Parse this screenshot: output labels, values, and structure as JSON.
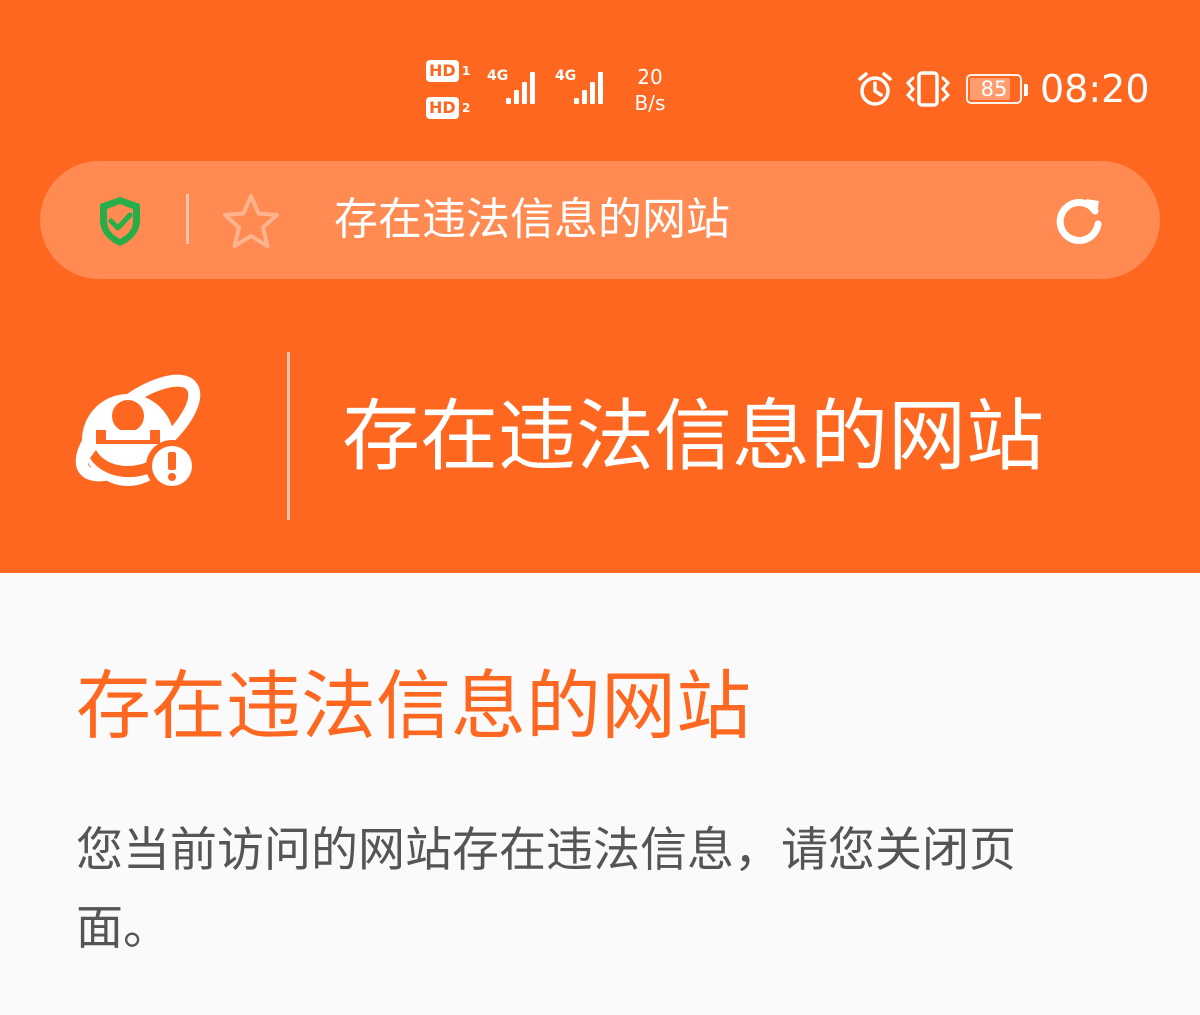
{
  "status_bar": {
    "sim1_badge": "HD",
    "sim1_number": "1",
    "sim2_badge": "HD",
    "sim2_number": "2",
    "network1": "4G",
    "network2": "4G",
    "speed_value": "20",
    "speed_unit": "B/s",
    "battery_level": "85",
    "time": "08:20",
    "icons": [
      "hd-badge-icon",
      "signal-icon",
      "alarm-icon",
      "vibrate-icon",
      "battery-icon"
    ]
  },
  "address_bar": {
    "title": "存在违法信息的网站",
    "icons": [
      "shield-check-icon",
      "star-icon",
      "refresh-icon"
    ]
  },
  "hero": {
    "title": "存在违法信息的网站",
    "icon": "browser-warning-icon"
  },
  "content": {
    "title": "存在违法信息的网站",
    "description": "您当前访问的网站存在违法信息，请您关闭页面。"
  },
  "colors": {
    "brand_orange": "#fe6720",
    "address_bar_bg": "#ff8a52",
    "shield_green": "#27ae48",
    "page_bg": "#fafafa",
    "body_text": "#555555"
  }
}
